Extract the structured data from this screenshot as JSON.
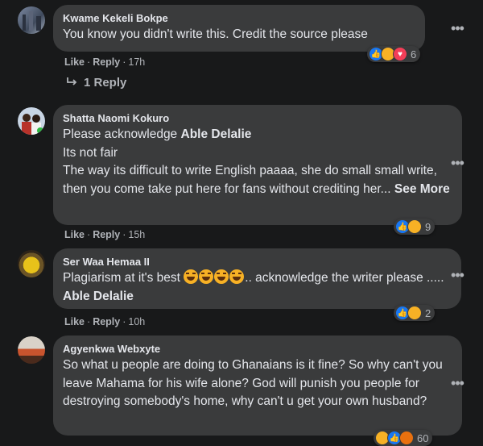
{
  "comments": [
    {
      "author": "Kwame Kekeli Bokpe",
      "text": "You know you didn't write this. Credit the source please",
      "like": "Like",
      "reply": "Reply",
      "time": "17h",
      "reaction_count": "6",
      "reply_count_label": "1 Reply"
    },
    {
      "author": "Shatta Naomi Kokuro",
      "line1_prefix": "Please acknowledge ",
      "line1_bold": "Able Delalie",
      "line2": "Its not fair",
      "line3": "The way its difficult to write English paaaa, she do small small write, then you come take put here for fans without crediting her... ",
      "see_more": "See More",
      "like": "Like",
      "reply": "Reply",
      "time": "15h",
      "reaction_count": "9"
    },
    {
      "author": "Ser Waa Hemaa II",
      "text_prefix": "Plagiarism at it's best ",
      "text_suffix": ".. acknowledge the writer please ..... ",
      "bold": "Able Delalie",
      "like": "Like",
      "reply": "Reply",
      "time": "10h",
      "reaction_count": "2"
    },
    {
      "author": "Agyenkwa Webxyte",
      "text": "So what u people are doing to Ghanaians is it fine? So why can't you leave Mahama for his wife alone? God will punish you people for destroying somebody's home, why can't u get your own husband?",
      "reaction_count": "60"
    }
  ],
  "more_icon": "more-horizontal-icon",
  "colors": {
    "background": "#18191a",
    "bubble": "#3a3b3c",
    "text": "#e4e6eb",
    "muted": "#b0b3b8",
    "like_blue": "#1877f2"
  }
}
